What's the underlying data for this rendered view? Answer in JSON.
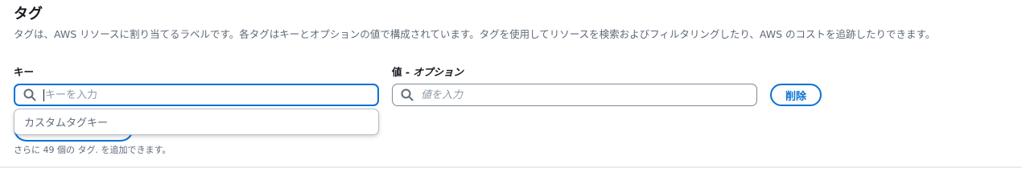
{
  "section": {
    "title": "タグ",
    "description": "タグは、AWS リソースに割り当てるラベルです。各タグはキーとオプションの値で構成されています。タグを使用してリソースを検索およびフィルタリングしたり、AWS のコストを追跡したりできます。"
  },
  "key_field": {
    "label": "キー",
    "placeholder": "キーを入力",
    "value": ""
  },
  "value_field": {
    "label_main": "値 - ",
    "label_optional": "オプション",
    "placeholder": "値を入力",
    "value": ""
  },
  "remove_button": {
    "label": "削除"
  },
  "dropdown": {
    "options": [
      "カスタムタグキー"
    ]
  },
  "hint": "さらに 49 個の タグ. を追加できます。",
  "icons": {
    "search": "search-icon"
  },
  "colors": {
    "accent": "#0972d3",
    "text": "#16191f",
    "secondary_text": "#5f6b7a",
    "border": "#7d8998"
  }
}
